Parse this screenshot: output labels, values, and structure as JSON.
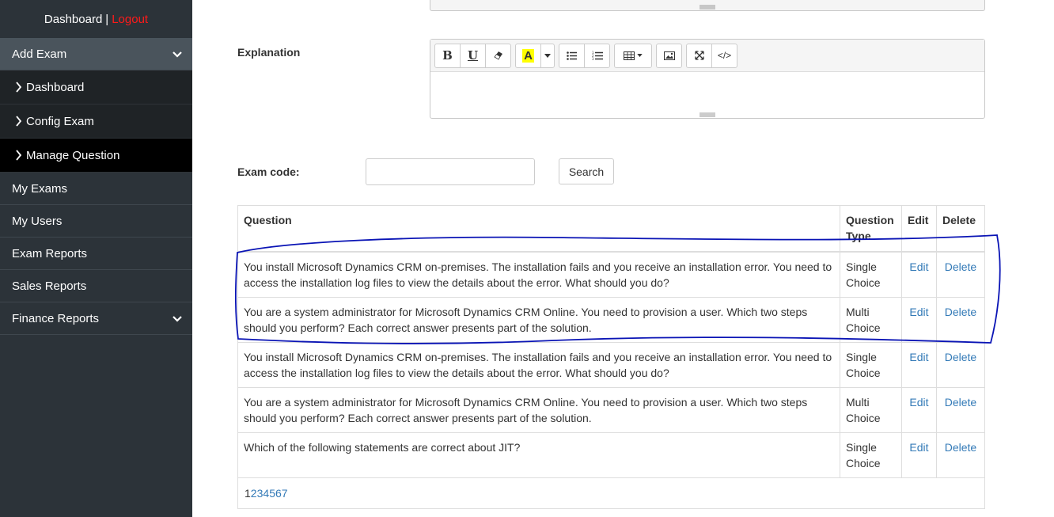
{
  "sidebar": {
    "top": {
      "dashboard": "Dashboard",
      "separator": "|",
      "logout": "Logout"
    },
    "add_exam": "Add Exam",
    "sub_items": [
      "Dashboard",
      "Config Exam",
      "Manage Question"
    ],
    "items": [
      "My Exams",
      "My Users",
      "Exam Reports",
      "Sales Reports",
      "Finance Reports"
    ]
  },
  "form": {
    "explanation_label": "Explanation",
    "exam_code_label": "Exam code:",
    "search_label": "Search",
    "search_value": ""
  },
  "editor_toolbar": {
    "bold": "B",
    "underline": "U",
    "font_color": "A",
    "code": "</>"
  },
  "table": {
    "headers": {
      "question": "Question",
      "type": "Question Type",
      "edit": "Edit",
      "delete": "Delete"
    },
    "rows": [
      {
        "question": "You install Microsoft Dynamics CRM on-premises. The installation fails and you receive an installation error. You need to access the installation log files to view the details about the error. What should you do?",
        "type": "Single Choice",
        "edit": "Edit",
        "delete": "Delete"
      },
      {
        "question": "You are a system administrator for Microsoft Dynamics CRM Online. You need to provision a user. Which two steps should you perform? Each correct answer presents part of the solution.",
        "type": "Multi Choice",
        "edit": "Edit",
        "delete": "Delete"
      },
      {
        "question": "You install Microsoft Dynamics CRM on-premises. The installation fails and you receive an installation error. You need to access the installation log files to view the details about the error. What should you do?",
        "type": "Single Choice",
        "edit": "Edit",
        "delete": "Delete"
      },
      {
        "question": "You are a system administrator for Microsoft Dynamics CRM Online. You need to provision a user. Which two steps should you perform? Each correct answer presents part of the solution.",
        "type": "Multi Choice",
        "edit": "Edit",
        "delete": "Delete"
      },
      {
        "question": "Which of the following statements are correct about JIT?",
        "type": "Single Choice",
        "edit": "Edit",
        "delete": "Delete"
      }
    ],
    "pages": [
      "1",
      "2",
      "3",
      "4",
      "5",
      "6",
      "7"
    ],
    "current_page": "1"
  },
  "colors": {
    "sidebar_bg": "#2c3339",
    "logout": "#ff1a1a",
    "link": "#337ab7",
    "annotation": "#0000cc"
  }
}
